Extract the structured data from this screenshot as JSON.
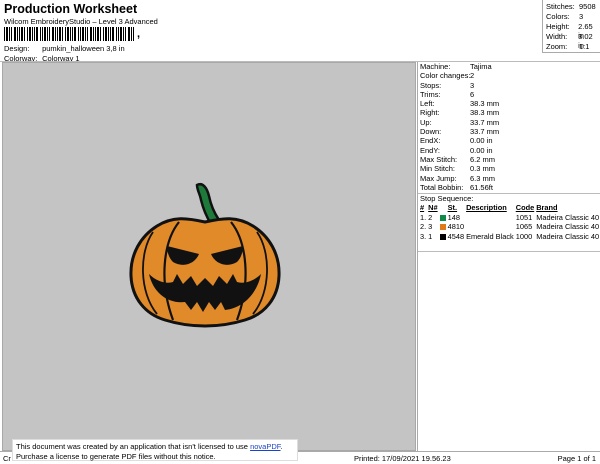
{
  "header": {
    "title": "Production Worksheet",
    "subtitle": "Wilcom EmbroideryStudio – Level 3 Advanced",
    "barcode_comma": ",",
    "design_label": "Design:",
    "design_value": "pumkin_halloween 3,8 in",
    "colorway_label": "Colorway:",
    "colorway_value": "Colorway 1"
  },
  "stats": [
    {
      "label": "Stitches:",
      "value": "9508"
    },
    {
      "label": "Colors:",
      "value": "3"
    },
    {
      "label": "Height:",
      "value": "2.65 in"
    },
    {
      "label": "Width:",
      "value": "3.02 in"
    },
    {
      "label": "Zoom:",
      "value": "1:1"
    }
  ],
  "machine_info": [
    {
      "label": "Machine:",
      "value": "Tajima"
    },
    {
      "label": "Color changes:",
      "value": "2"
    },
    {
      "label": "Stops:",
      "value": "3"
    },
    {
      "label": "Trims:",
      "value": "6"
    },
    {
      "label": "Left:",
      "value": "38.3 mm"
    },
    {
      "label": "Right:",
      "value": "38.3 mm"
    },
    {
      "label": "Up:",
      "value": "33.7 mm"
    },
    {
      "label": "Down:",
      "value": "33.7 mm"
    },
    {
      "label": "EndX:",
      "value": "0.00 in"
    },
    {
      "label": "EndY:",
      "value": "0.00 in"
    },
    {
      "label": "Max Stitch:",
      "value": "6.2 mm"
    },
    {
      "label": "Min Stitch:",
      "value": "0.3 mm"
    },
    {
      "label": "Max Jump:",
      "value": "6.3 mm"
    },
    {
      "label": "Total Bobbin:",
      "value": "61.56ft"
    }
  ],
  "stop_sequence": {
    "title": "Stop Sequence:",
    "headers": {
      "hash": "#",
      "num": "N#",
      "st": "St.",
      "desc": "Description",
      "code": "Code",
      "brand": "Brand"
    },
    "rows": [
      {
        "idx": "1.",
        "num": "2",
        "color": "#0f8a4a",
        "st": "148",
        "desc": "",
        "code": "1051",
        "brand": "Madeira Classic 40"
      },
      {
        "idx": "2.",
        "num": "3",
        "color": "#e07a18",
        "st": "4810",
        "desc": "",
        "code": "1065",
        "brand": "Madeira Classic 40"
      },
      {
        "idx": "3.",
        "num": "1",
        "color": "#000000",
        "st": "4548",
        "desc": "Emerald Black",
        "code": "1000",
        "brand": "Madeira Classic 40"
      }
    ]
  },
  "footer": {
    "left": "Cr",
    "printed": "Printed: 17/09/2021 19.56.23",
    "page": "Page 1 of 1"
  },
  "notice": {
    "line1_prefix": "This document was created by an application that isn't licensed to use ",
    "link": "novaPDF",
    "line1_suffix": ".",
    "line2": "Purchase a license to generate PDF files without this notice."
  },
  "colors": {
    "pumpkin_fill": "#e08a2a",
    "stem": "#1e7a3a",
    "outline": "#111111",
    "canvas_bg": "#c4c4c4"
  }
}
